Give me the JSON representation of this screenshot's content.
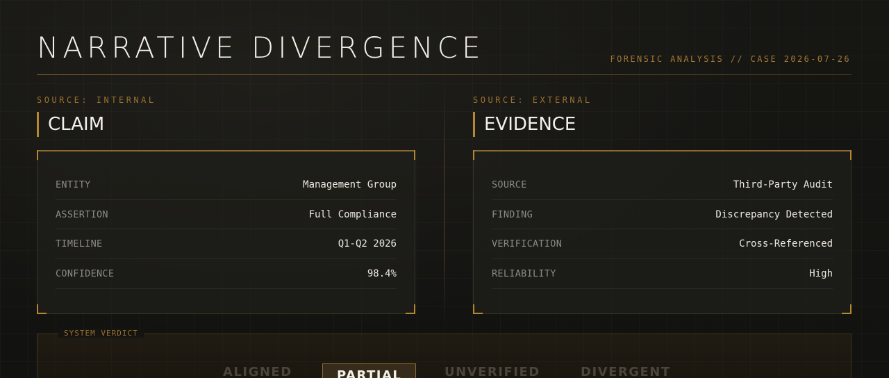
{
  "header": {
    "title": "NARRATIVE DIVERGENCE",
    "meta": "FORENSIC ANALYSIS // CASE 2026-07-26"
  },
  "claim": {
    "kicker": "SOURCE: INTERNAL",
    "heading": "CLAIM",
    "rows": [
      {
        "label": "ENTITY",
        "value": "Management Group"
      },
      {
        "label": "ASSERTION",
        "value": "Full Compliance"
      },
      {
        "label": "TIMELINE",
        "value": "Q1-Q2 2026"
      },
      {
        "label": "CONFIDENCE",
        "value": "98.4%"
      }
    ]
  },
  "evidence": {
    "kicker": "SOURCE: EXTERNAL",
    "heading": "EVIDENCE",
    "rows": [
      {
        "label": "SOURCE",
        "value": "Third-Party Audit"
      },
      {
        "label": "FINDING",
        "value": "Discrepancy Detected"
      },
      {
        "label": "VERIFICATION",
        "value": "Cross-Referenced"
      },
      {
        "label": "RELIABILITY",
        "value": "High"
      }
    ]
  },
  "verdict": {
    "label": "SYSTEM VERDICT",
    "options": [
      "ALIGNED",
      "PARTIAL",
      "UNVERIFIED",
      "DIVERGENT"
    ],
    "selected": "PARTIAL"
  },
  "colors": {
    "accent": "#b8862f",
    "background": "#121210",
    "text": "#e8e4dc",
    "muted": "#8d8a84"
  }
}
